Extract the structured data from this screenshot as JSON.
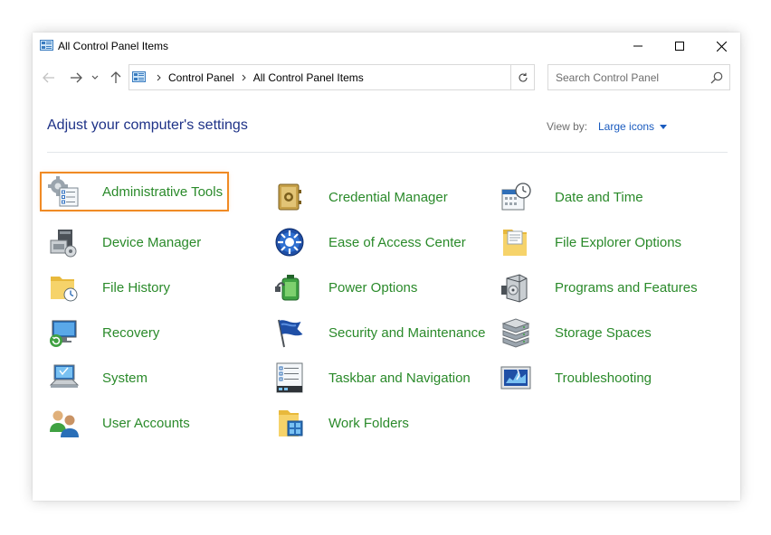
{
  "window": {
    "title": "All Control Panel Items"
  },
  "address_bar": {
    "crumbs": [
      "Control Panel",
      "All Control Panel Items"
    ]
  },
  "search": {
    "placeholder": "Search Control Panel"
  },
  "header": {
    "heading": "Adjust your computer's settings",
    "view_by_label": "View by:",
    "view_by_value": "Large icons"
  },
  "items": [
    {
      "label": "Administrative Tools",
      "icon": "administrative-tools-icon",
      "selected": true
    },
    {
      "label": "Credential Manager",
      "icon": "credential-manager-icon"
    },
    {
      "label": "Date and Time",
      "icon": "date-time-icon"
    },
    {
      "label": "Device Manager",
      "icon": "device-manager-icon"
    },
    {
      "label": "Ease of Access Center",
      "icon": "ease-of-access-icon"
    },
    {
      "label": "File Explorer Options",
      "icon": "file-explorer-options-icon"
    },
    {
      "label": "File History",
      "icon": "file-history-icon"
    },
    {
      "label": "Power Options",
      "icon": "power-options-icon"
    },
    {
      "label": "Programs and Features",
      "icon": "programs-features-icon"
    },
    {
      "label": "Recovery",
      "icon": "recovery-icon"
    },
    {
      "label": "Security and Maintenance",
      "icon": "security-maintenance-icon"
    },
    {
      "label": "Storage Spaces",
      "icon": "storage-spaces-icon"
    },
    {
      "label": "System",
      "icon": "system-icon"
    },
    {
      "label": "Taskbar and Navigation",
      "icon": "taskbar-navigation-icon"
    },
    {
      "label": "Troubleshooting",
      "icon": "troubleshooting-icon"
    },
    {
      "label": "User Accounts",
      "icon": "user-accounts-icon"
    },
    {
      "label": "Work Folders",
      "icon": "work-folders-icon"
    }
  ],
  "colors": {
    "link_green": "#2a8a2a",
    "heading_blue": "#1e3287",
    "selection_orange": "#f08a24"
  }
}
